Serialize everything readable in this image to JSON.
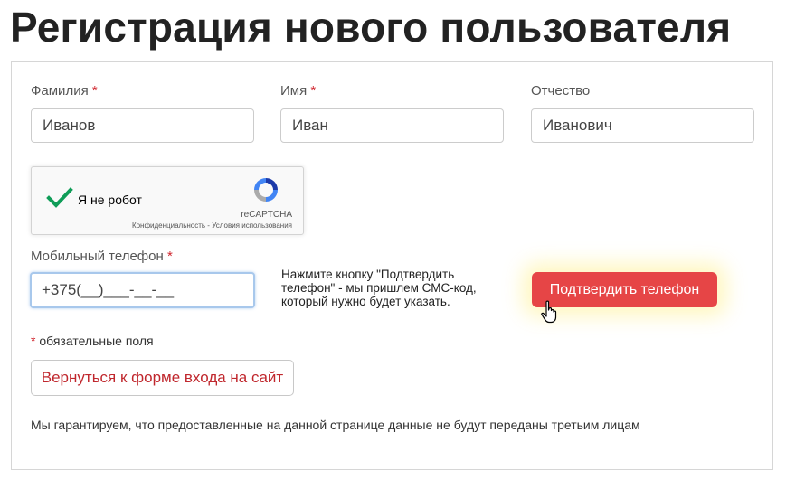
{
  "page": {
    "title": "Регистрация нового пользователя"
  },
  "form": {
    "last_name": {
      "label": "Фамилия",
      "required_mark": "*",
      "value": "Иванов"
    },
    "first_name": {
      "label": "Имя",
      "required_mark": "*",
      "value": "Иван"
    },
    "middle_name": {
      "label": "Отчество",
      "value": "Иванович"
    },
    "captcha": {
      "label": "Я не робот",
      "brand": "reCAPTCHA",
      "terms": "Конфиденциальность - Условия использования",
      "checked": true,
      "check_color": "#0f9d58"
    },
    "phone": {
      "label": "Мобильный телефон",
      "required_mark": "*",
      "value": "+375(__)___-__-__"
    },
    "phone_hint": "Нажмите кнопку \"Подтвердить телефон\" - мы пришлем СМС-код, который нужно будет указать.",
    "confirm_button": "Подтвердить телефон",
    "required_note": {
      "mark": "*",
      "text": " обязательные поля"
    },
    "back_button": "Вернуться к форме входа на сайт",
    "guarantee": "Мы гарантируем, что предоставленные на данной странице данные не будут переданы третьим лицам"
  },
  "colors": {
    "accent": "#e64546",
    "required": "#d0262e",
    "focus_border": "#a8c8ec"
  }
}
